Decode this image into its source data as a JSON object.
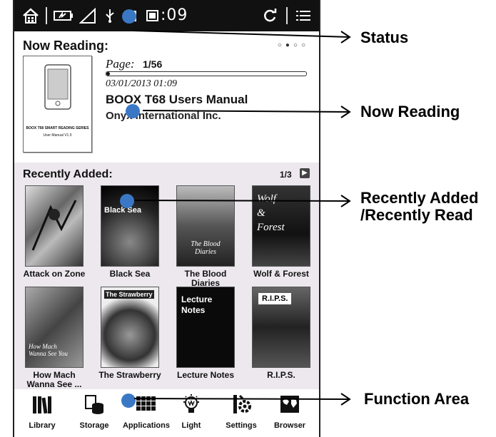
{
  "status_bar": {
    "time": ":09",
    "icons": [
      "home-icon",
      "battery-icon",
      "signal-icon",
      "usb-icon",
      "sd-card-icon",
      "refresh-icon",
      "menu-icon"
    ]
  },
  "now_reading": {
    "title": "Now Reading:",
    "page_label": "Page:",
    "page_value": "1/56",
    "progress": 0.018,
    "date": "03/01/2013 01:09",
    "book_title": "BOOX T68 Users Manual",
    "author": "Onyx International Inc.",
    "cover_text_1": "BOOX T68 SMART READING SERIES",
    "cover_text_2": "User Manual V1.5"
  },
  "recently_added": {
    "title": "Recently Added:",
    "page": "1/3",
    "books": [
      {
        "label": "Attack on Zone",
        "cover_text": ""
      },
      {
        "label": "Black Sea",
        "cover_text": "Black Sea"
      },
      {
        "label": "The Blood Diaries",
        "cover_text": "The Blood Diaries"
      },
      {
        "label": "Wolf & Forest",
        "cover_text": "Wolf & Forest"
      },
      {
        "label": "How Mach Wanna See ...",
        "cover_text": "How Mach Wanna See You"
      },
      {
        "label": "The Strawberry",
        "cover_text": "The Strawberry"
      },
      {
        "label": "Lecture Notes",
        "cover_text": "Lecture Notes"
      },
      {
        "label": "R.I.P.S.",
        "cover_text": "R.I.P.S."
      }
    ]
  },
  "function_area": {
    "items": [
      {
        "label": "Library",
        "icon": "library-icon"
      },
      {
        "label": "Storage",
        "icon": "storage-icon"
      },
      {
        "label": "Applications",
        "icon": "applications-icon"
      },
      {
        "label": "Light",
        "icon": "light-icon"
      },
      {
        "label": "Settings",
        "icon": "settings-icon"
      },
      {
        "label": "Browser",
        "icon": "browser-icon"
      }
    ]
  },
  "annotations": {
    "status": "Status",
    "now_reading": "Now Reading",
    "recently_line1": "Recently Added",
    "recently_line2": "/Recently Read",
    "function_area": "Function Area"
  },
  "colors": {
    "status_bar": "#111111",
    "recent_bg": "#ece8ee",
    "marker": "#3a78c6"
  }
}
